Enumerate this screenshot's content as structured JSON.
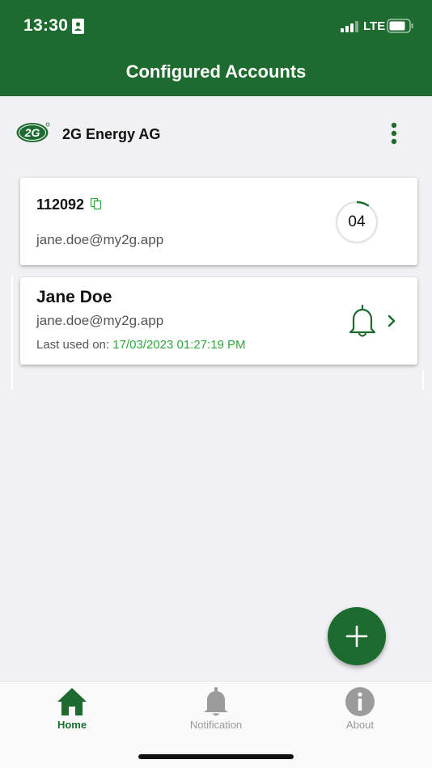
{
  "status_bar": {
    "time": "13:30",
    "network": "LTE"
  },
  "header": {
    "title": "Configured Accounts"
  },
  "brand": {
    "logo_text": "2G",
    "name": "2G Energy AG"
  },
  "accounts": [
    {
      "id": "112092",
      "email": "jane.doe@my2g.app",
      "otp_code": "04",
      "otp_progress": 0.1
    },
    {
      "name": "Jane Doe",
      "email": "jane.doe@my2g.app",
      "last_used_label": "Last used on:",
      "last_used_value": "17/03/2023 01:27:19 PM"
    }
  ],
  "tabs": [
    {
      "label": "Home",
      "icon": "home-icon",
      "active": true
    },
    {
      "label": "Notification",
      "icon": "bell-icon",
      "active": false
    },
    {
      "label": "About",
      "icon": "info-icon",
      "active": false
    }
  ],
  "colors": {
    "primary": "#1e6b2f",
    "accent_green": "#2ea83a",
    "background": "#f1f1f4"
  }
}
